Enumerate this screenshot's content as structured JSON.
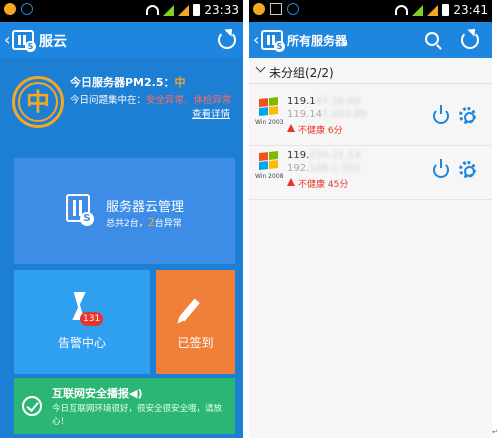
{
  "left_screen": {
    "status_bar": {
      "time": "23:33"
    },
    "app_bar": {
      "title": "服云",
      "back_icon": "chevron-left-icon",
      "refresh_icon": "refresh-icon"
    },
    "pm": {
      "ring_level": "中",
      "line1_prefix": "今日服务器PM2.5：",
      "line1_level": "中",
      "line2_prefix": "今日问题集中在：",
      "line2_issues": "安全异常、体检异常",
      "detail_link": "查看详情"
    },
    "tiles": {
      "cloud": {
        "title": "服务器云管理",
        "sub_prefix": "总共2台，",
        "sub_count": "2",
        "sub_suffix": "台异常"
      },
      "alert": {
        "label": "告警中心",
        "badge": "131"
      },
      "sign": {
        "label": "已签到"
      },
      "news": {
        "title": "互联网安全播报◀)",
        "text": "今日互联网环境很好，很安全很安全哦，请放心！"
      }
    }
  },
  "right_screen": {
    "status_bar": {
      "time": "23:41"
    },
    "app_bar": {
      "title": "所有服务器"
    },
    "group": {
      "label": "未分组(2/2)"
    },
    "servers": [
      {
        "os_label": "Win 2003",
        "ip1_visible": "119.1",
        "ip1_blurred": "47.38.89",
        "ip2_visible": "119.14",
        "ip2_blurred": "7.103.89",
        "status": "不健康 6分"
      },
      {
        "os_label": "Win 2008",
        "ip1_visible": "119.",
        "ip1_blurred": "154.21.13",
        "ip2_visible": "192.",
        "ip2_blurred": "168.1.203",
        "status": "不健康 45分"
      }
    ]
  },
  "colors": {
    "primary_blue": "#1f86e0",
    "warning_orange": "#f5a623",
    "danger_red": "#e8342c",
    "success_green": "#2bb673",
    "sign_orange": "#f07f3a"
  }
}
